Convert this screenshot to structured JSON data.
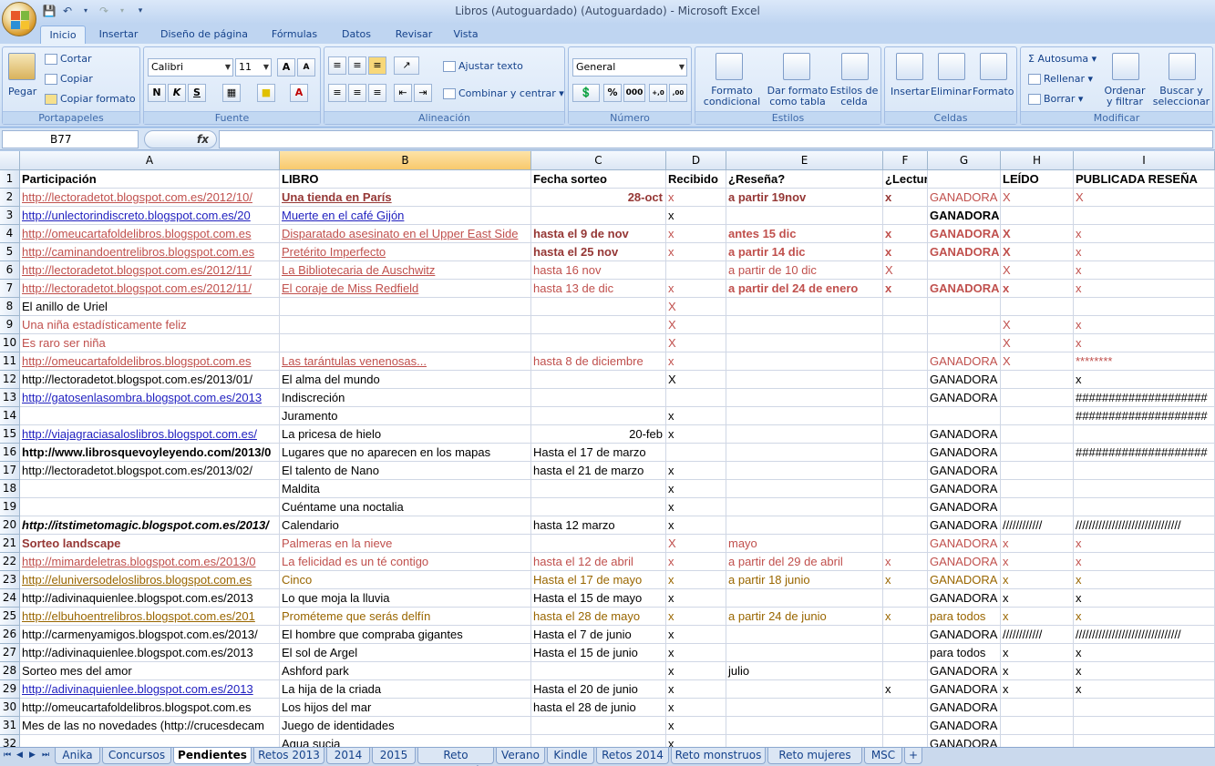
{
  "window": {
    "title": "Libros (Autoguardado) (Autoguardado) - Microsoft Excel"
  },
  "ribbon_tabs": [
    "Inicio",
    "Insertar",
    "Diseño de página",
    "Fórmulas",
    "Datos",
    "Revisar",
    "Vista"
  ],
  "ribbon": {
    "portapapeles": {
      "label": "Portapapeles",
      "pegar": "Pegar",
      "cortar": "Cortar",
      "copiar": "Copiar",
      "copiar_formato": "Copiar formato"
    },
    "fuente": {
      "label": "Fuente",
      "font": "Calibri",
      "size": "11",
      "bold": "N",
      "italic": "K",
      "underline": "S",
      "grow": "A",
      "shrink": "A",
      "color": "A"
    },
    "alineacion": {
      "label": "Alineación",
      "ajustar": "Ajustar texto",
      "combinar": "Combinar y centrar"
    },
    "numero": {
      "label": "Número",
      "format": "General",
      "percent": "%",
      "thousands": "000",
      "inc": "+,0",
      "dec": ",00"
    },
    "estilos": {
      "label": "Estilos",
      "formato_condicional": "Formato condicional",
      "dar_formato": "Dar formato como tabla",
      "estilos_celda": "Estilos de celda"
    },
    "celdas": {
      "label": "Celdas",
      "insertar": "Insertar",
      "eliminar": "Eliminar",
      "formato": "Formato"
    },
    "modificar": {
      "label": "Modificar",
      "autosuma": "Autosuma",
      "rellenar": "Rellenar",
      "borrar": "Borrar",
      "ordenar": "Ordenar y filtrar",
      "buscar": "Buscar y seleccionar"
    }
  },
  "formula_bar": {
    "name_box": "B77",
    "fx": "fx",
    "content": ""
  },
  "columns": [
    "A",
    "B",
    "C",
    "D",
    "E",
    "F",
    "G",
    "H",
    "I"
  ],
  "selected_column": "B",
  "rows": [
    {
      "n": "1",
      "cells": [
        "Participación",
        "LIBRO",
        "Fecha sorteo",
        "Recibido",
        "¿Reseña?",
        "¿Lectura conjunta?",
        "",
        "LEÍDO",
        "PUBLICADA RESEÑA"
      ]
    },
    {
      "n": "2",
      "cells": [
        "http://lectoradetot.blogspot.com.es/2012/10/",
        "Una tienda en París",
        "28-oct",
        "x",
        "a partir 19nov",
        "x",
        "GANADORA",
        "X",
        "X"
      ]
    },
    {
      "n": "3",
      "cells": [
        "http://unlectorindiscreto.blogspot.com.es/20",
        "Muerte en el café Gijón",
        "",
        "x",
        "",
        "",
        "GANADORA",
        "",
        ""
      ]
    },
    {
      "n": "4",
      "cells": [
        "http://omeucartafoldelibros.blogspot.com.es",
        "Disparatado asesinato en el Upper East Side",
        "hasta el 9 de nov",
        "x",
        "antes 15 dic",
        "x",
        "GANADORA",
        "X",
        "x"
      ]
    },
    {
      "n": "5",
      "cells": [
        "http://caminandoentrelibros.blogspot.com.es",
        "Pretérito Imperfecto",
        "hasta el 25 nov",
        "x",
        "a partir 14 dic",
        "x",
        "GANADORA",
        "X",
        "x"
      ]
    },
    {
      "n": "6",
      "cells": [
        "http://lectoradetot.blogspot.com.es/2012/11/",
        "La Bibliotecaria de Auschwitz",
        "hasta 16 nov",
        "",
        "a partir de 10 dic",
        "X",
        "",
        "X",
        "x"
      ]
    },
    {
      "n": "7",
      "cells": [
        "http://lectoradetot.blogspot.com.es/2012/11/",
        "El coraje de Miss Redfield",
        "hasta 13 de dic",
        "x",
        "a partir del 24 de enero",
        "x",
        "GANADORA",
        "x",
        "x"
      ]
    },
    {
      "n": "8",
      "cells": [
        "El anillo de Uriel",
        "",
        "",
        "X",
        "",
        "",
        "",
        "",
        ""
      ]
    },
    {
      "n": "9",
      "cells": [
        "Una niña estadísticamente feliz",
        "",
        "",
        "X",
        "",
        "",
        "",
        "X",
        "x"
      ]
    },
    {
      "n": "10",
      "cells": [
        "Es raro ser niña",
        "",
        "",
        "X",
        "",
        "",
        "",
        "X",
        "x"
      ]
    },
    {
      "n": "11",
      "cells": [
        "http://omeucartafoldelibros.blogspot.com.es",
        "Las tarántulas venenosas...",
        "hasta 8 de diciembre",
        "x",
        "",
        "",
        "GANADORA",
        "X",
        "********"
      ]
    },
    {
      "n": "12",
      "cells": [
        "http://lectoradetot.blogspot.com.es/2013/01/",
        "El alma del mundo",
        "",
        "X",
        "",
        "",
        "GANADORA",
        "",
        "x"
      ]
    },
    {
      "n": "13",
      "cells": [
        "http://gatosenlasombra.blogspot.com.es/2013",
        "Indiscreción",
        "",
        "",
        "",
        "",
        "GANADORA",
        "",
        "####################"
      ]
    },
    {
      "n": "14",
      "cells": [
        "",
        "Juramento",
        "",
        "x",
        "",
        "",
        "",
        "",
        "####################"
      ]
    },
    {
      "n": "15",
      "cells": [
        "http://viajagraciasaloslibros.blogspot.com.es/",
        "La pricesa de hielo",
        "20-feb",
        "x",
        "",
        "",
        "GANADORA",
        "",
        ""
      ]
    },
    {
      "n": "16",
      "cells": [
        "http://www.librosquevoyleyendo.com/2013/0",
        "Lugares que no aparecen en los mapas",
        "Hasta el 17 de marzo",
        "",
        "",
        "",
        "GANADORA",
        "",
        "####################"
      ]
    },
    {
      "n": "17",
      "cells": [
        "http://lectoradetot.blogspot.com.es/2013/02/",
        "El talento de Nano",
        "hasta el 21 de marzo",
        "x",
        "",
        "",
        "GANADORA",
        "",
        ""
      ]
    },
    {
      "n": "18",
      "cells": [
        "",
        "Maldita",
        "",
        "x",
        "",
        "",
        "GANADORA",
        "",
        ""
      ]
    },
    {
      "n": "19",
      "cells": [
        "",
        "Cuéntame una noctalia",
        "",
        "x",
        "",
        "",
        "GANADORA",
        "",
        ""
      ]
    },
    {
      "n": "20",
      "cells": [
        "http://itstimetomagic.blogspot.com.es/2013/",
        "Calendario",
        "hasta 12 marzo",
        "x",
        "",
        "",
        "GANADORA",
        "////////////",
        "////////////////////////////////"
      ]
    },
    {
      "n": "21",
      "cells": [
        "Sorteo landscape",
        "Palmeras en la nieve",
        "",
        "X",
        "mayo",
        "",
        "GANADORA",
        "x",
        "x"
      ]
    },
    {
      "n": "22",
      "cells": [
        "http://mimardeletras.blogspot.com.es/2013/0",
        "La felicidad es un té contigo",
        "hasta el 12 de abril",
        "x",
        "a partir del 29 de abril",
        "x",
        "GANADORA",
        "x",
        "x"
      ]
    },
    {
      "n": "23",
      "cells": [
        "http://eluniversodeloslibros.blogspot.com.es",
        "Cinco",
        "Hasta el 17 de mayo",
        "x",
        "a partir 18 junio",
        "x",
        "GANADORA",
        "x",
        "x"
      ]
    },
    {
      "n": "24",
      "cells": [
        "http://adivinaquienlee.blogspot.com.es/2013",
        "Lo que moja la lluvia",
        "Hasta el 15 de mayo",
        "x",
        "",
        "",
        "GANADORA",
        "x",
        "x"
      ]
    },
    {
      "n": "25",
      "cells": [
        "http://elbuhoentrelibros.blogspot.com.es/201",
        "Prométeme que serás delfín",
        "hasta el 28 de mayo",
        "x",
        "a partir 24 de junio",
        "x",
        "para todos",
        "x",
        "x"
      ]
    },
    {
      "n": "26",
      "cells": [
        "http://carmenyamigos.blogspot.com.es/2013/",
        "El hombre que compraba gigantes",
        "Hasta el 7 de junio",
        "x",
        "",
        "",
        "GANADORA",
        "////////////",
        "////////////////////////////////"
      ]
    },
    {
      "n": "27",
      "cells": [
        "http://adivinaquienlee.blogspot.com.es/2013",
        "El sol de Argel",
        "Hasta el 15 de junio",
        "x",
        "",
        "",
        "para todos",
        "x",
        "x"
      ]
    },
    {
      "n": "28",
      "cells": [
        "Sorteo mes del amor",
        "Ashford park",
        "",
        "x",
        "julio",
        "",
        "GANADORA",
        "x",
        "x"
      ]
    },
    {
      "n": "29",
      "cells": [
        "http://adivinaquienlee.blogspot.com.es/2013",
        "La hija de la criada",
        "Hasta el 20 de junio",
        "x",
        "",
        "x",
        "GANADORA",
        "x",
        "x"
      ]
    },
    {
      "n": "30",
      "cells": [
        "http://omeucartafoldelibros.blogspot.com.es",
        "Los hijos del mar",
        "hasta el 28 de junio",
        "x",
        "",
        "",
        "GANADORA",
        "",
        ""
      ]
    },
    {
      "n": "31",
      "cells": [
        "Mes de las no novedades (http://crucesdecam",
        "Juego de identidades",
        "",
        "x",
        "",
        "",
        "GANADORA",
        "",
        ""
      ]
    },
    {
      "n": "32",
      "cells": [
        "",
        "Agua sucia",
        "",
        "x",
        "",
        "",
        "GANADORA",
        "",
        ""
      ]
    }
  ],
  "sheet_tabs": [
    "Anika",
    "Concursos",
    "Pendientes",
    "Retos 2013",
    "2014",
    "2015",
    "Reto mensual",
    "Verano",
    "Kindle",
    "Retos 2014",
    "Reto monstruos",
    "Reto mujeres",
    "MSC"
  ],
  "active_sheet": "Pendientes",
  "colors": {
    "red": "#c0392b",
    "brown": "#953735",
    "orange": "#c0504d",
    "link_blue": "#1f1fbf",
    "gold": "#996600"
  }
}
